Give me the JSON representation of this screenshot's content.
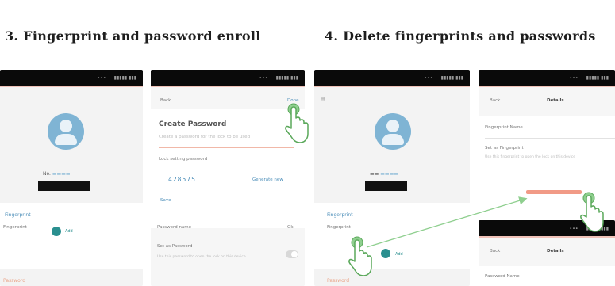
{
  "headings": {
    "enroll": "3. Fingerprint and password enroll",
    "delete": "4. Delete fingerprints and passwords"
  },
  "status_bar": {
    "left": "∙∙∙",
    "right": "▮▮▮▮▮ ▮▮▮"
  },
  "phone1": {
    "user_prefix": "No.",
    "fingerprint_section": "Fingerprint",
    "fingerprint_item": "Fingerprint",
    "teal_label": "Add",
    "password_section": "Password"
  },
  "phone2": {
    "back": "Back",
    "done": "Done",
    "title": "Create Password",
    "subtitle": "Create a password for the lock to be used",
    "pwd_label": "Lock setting password",
    "pwd_value": "428575",
    "generate": "Generate new",
    "save": "Save",
    "row1": "Password name",
    "row1_value": "Ok",
    "row2": "Set as Password",
    "row2_desc": "Use this password to open the lock on this device"
  },
  "phone3": {
    "fingerprint_section": "Fingerprint",
    "fingerprint_item": "Fingerprint",
    "teal_label": "Add",
    "password_section": "Password"
  },
  "phone4": {
    "back": "Back",
    "title": "Details",
    "row1": "Fingerprint Name",
    "row2": "Set as Fingerprint",
    "row2_desc": "Use this fingerprint to open the lock on this device",
    "row3": "Password Name"
  },
  "colors": {
    "accent_blue": "#4a8db8",
    "teal": "#2a8f8f",
    "hint_green": "#8fcf8f",
    "alert_red": "#f19a86"
  }
}
